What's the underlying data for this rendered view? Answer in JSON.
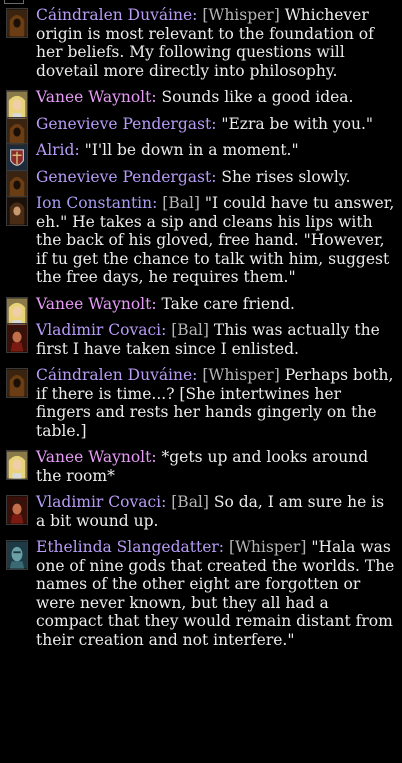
{
  "messages": [
    {
      "speaker": "Cáindralen Duváine:",
      "tag": "[Whisper]",
      "text": " Whichever origin is most relevant to the foundation of her beliefs. My following questions will dovetail more directly into philosophy.",
      "avatar": "hooded-brown"
    },
    {
      "speaker": "Vanee Waynolt:",
      "tag": "",
      "text": " Sounds like a good idea.",
      "avatar": "blonde"
    },
    {
      "speaker": "Genevieve Pendergast:",
      "tag": "",
      "text": " \"Ezra be with you.\"",
      "avatar": "hooded-brown"
    },
    {
      "speaker": "Alrid:",
      "tag": "",
      "text": " \"I'll be down in a moment.\"",
      "avatar": "shield"
    },
    {
      "speaker": "Genevieve Pendergast:",
      "tag": "",
      "text": " She rises slowly.",
      "avatar": "hooded-brown"
    },
    {
      "speaker": "Ion Constantin:",
      "tag": "[Bal]",
      "text": " \"I could have tu answer, eh.\" He takes a sip and cleans his lips with the back of his gloved, free hand. \"However, if tu get the chance to talk with him, suggest the free days, he requires them.\"",
      "avatar": "hooded-dark"
    },
    {
      "speaker": "Vanee Waynolt:",
      "tag": "",
      "text": " Take care friend.",
      "avatar": "blonde"
    },
    {
      "speaker": "Vladimir Covaci:",
      "tag": "[Bal]",
      "text": " This was actually the first I have taken since I enlisted.",
      "avatar": "red-warrior"
    },
    {
      "speaker": "Cáindralen Duváine:",
      "tag": "[Whisper]",
      "text": " Perhaps both, if there is time...? [She intertwines her fingers and rests her hands gingerly on the table.]",
      "avatar": "hooded-brown"
    },
    {
      "speaker": "Vanee Waynolt:",
      "tag": "",
      "text": " *gets up and looks around the room*",
      "avatar": "blonde"
    },
    {
      "speaker": "Vladimir Covaci:",
      "tag": "[Bal]",
      "text": " So da, I am sure he is a bit wound up.",
      "avatar": "red-warrior"
    },
    {
      "speaker": "Ethelinda Slangedatter:",
      "tag": "[Whisper]",
      "text": " \"Hala was one of nine gods that created the worlds. The names of the other eight are forgotten or were never known, but they all had a compact that they would remain distant from their creation and not interfere.\"",
      "avatar": "teal-face"
    }
  ]
}
